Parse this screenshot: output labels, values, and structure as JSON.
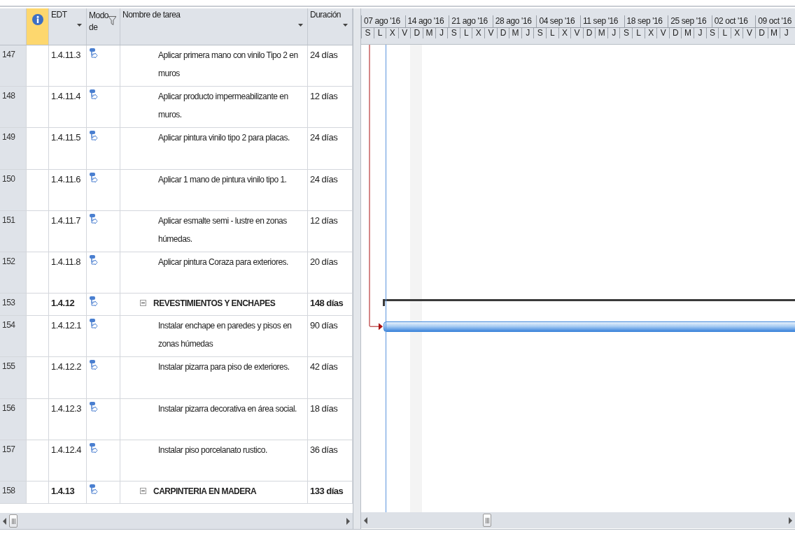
{
  "table": {
    "columns": [
      {
        "kind": "info"
      },
      {
        "kind": "text",
        "label": "EDT",
        "dropdown": true
      },
      {
        "kind": "filter",
        "label": "Modo de"
      },
      {
        "kind": "text",
        "label": "Nombre de tarea",
        "dropdown": true
      },
      {
        "kind": "text",
        "label": "Duración",
        "dropdown": true
      }
    ],
    "rows": [
      {
        "id": "147",
        "edt": "1.4.11.3",
        "name": "Aplicar primera mano con vinilo Tipo 2 en muros",
        "duration": "24 días",
        "summary": false,
        "gantt_bar": false
      },
      {
        "id": "148",
        "edt": "1.4.11.4",
        "name": "Aplicar producto impermeabilizante en muros.",
        "duration": "12 días",
        "summary": false,
        "gantt_bar": false
      },
      {
        "id": "149",
        "edt": "1.4.11.5",
        "name": "Aplicar pintura vinilo tipo 2 para placas.",
        "duration": "24 días",
        "summary": false,
        "gantt_bar": false
      },
      {
        "id": "150",
        "edt": "1.4.11.6",
        "name": "Aplicar 1 mano de pintura vinilo tipo 1.",
        "duration": "24 días",
        "summary": false,
        "gantt_bar": false
      },
      {
        "id": "151",
        "edt": "1.4.11.7",
        "name": "Aplicar esmalte semi - lustre en zonas húmedas.",
        "duration": "12 días",
        "summary": false,
        "gantt_bar": false
      },
      {
        "id": "152",
        "edt": "1.4.11.8",
        "name": "Aplicar pintura Coraza para exteriores.",
        "duration": "20 días",
        "summary": false,
        "gantt_bar": false
      },
      {
        "id": "153",
        "edt": "1.4.12",
        "name": "REVESTIMIENTOS Y ENCHAPES",
        "duration": "148 días",
        "summary": true,
        "expanded": true,
        "gantt_bar": true
      },
      {
        "id": "154",
        "edt": "1.4.12.1",
        "name": "Instalar enchape en paredes y pisos en zonas húmedas",
        "duration": "90 días",
        "summary": false,
        "gantt_bar": true
      },
      {
        "id": "155",
        "edt": "1.4.12.2",
        "name": "Instalar pizarra para piso de exteriores.",
        "duration": "42 días",
        "summary": false,
        "gantt_bar": false
      },
      {
        "id": "156",
        "edt": "1.4.12.3",
        "name": "Instalar pizarra decorativa en área social.",
        "duration": "18 días",
        "summary": false,
        "gantt_bar": false
      },
      {
        "id": "157",
        "edt": "1.4.12.4",
        "name": "Instalar piso porcelanato rustico.",
        "duration": "36 días",
        "summary": false,
        "gantt_bar": false
      },
      {
        "id": "158",
        "edt": "1.4.13",
        "name": "CARPINTERIA EN MADERA",
        "duration": "133 días",
        "summary": true,
        "expanded": true,
        "gantt_bar": false
      }
    ]
  },
  "timescale": {
    "weeks": [
      "07 ago '16",
      "14 ago '16",
      "21 ago '16",
      "28 ago '16",
      "04 sep '16",
      "11 sep '16",
      "18 sep '16",
      "25 sep '16",
      "02 oct '16",
      "09 oct '16"
    ],
    "days": [
      "S",
      "L",
      "X",
      "V",
      "D",
      "M",
      "J",
      "S",
      "L",
      "X",
      "V",
      "D",
      "M",
      "J",
      "S",
      "L",
      "X",
      "V",
      "D",
      "M",
      "J",
      "S",
      "L",
      "X",
      "V",
      "D",
      "M",
      "J",
      "S",
      "L",
      "X",
      "V",
      "D",
      "M",
      "J"
    ]
  }
}
